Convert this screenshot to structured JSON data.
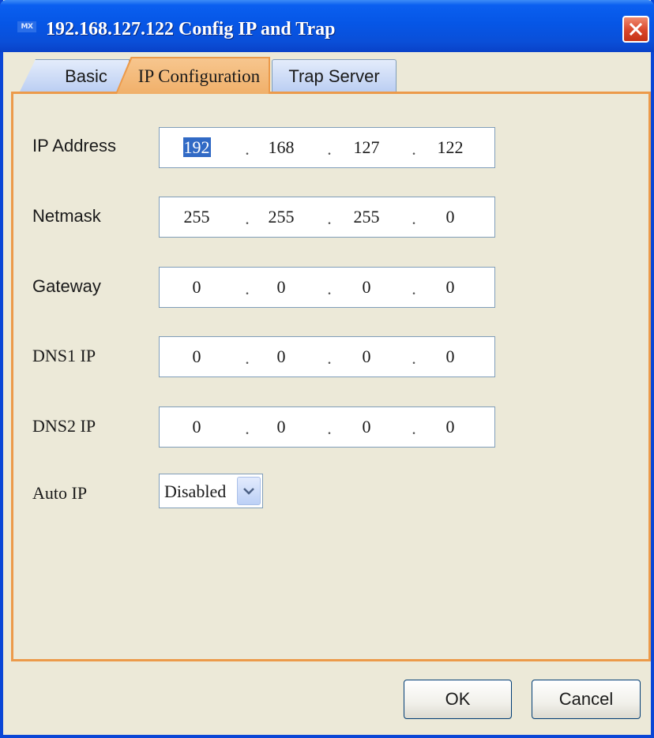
{
  "window": {
    "icon_text": "MX",
    "title": "192.168.127.122 Config IP and Trap"
  },
  "tabs": [
    {
      "label": "Basic",
      "selected": false
    },
    {
      "label": "IP Configuration",
      "selected": true
    },
    {
      "label": "Trap Server",
      "selected": false
    }
  ],
  "form": {
    "ip_address": {
      "label": "IP Address",
      "octets": [
        "192",
        "168",
        "127",
        "122"
      ],
      "separator": "."
    },
    "netmask": {
      "label": "Netmask",
      "octets": [
        "255",
        "255",
        "255",
        "0"
      ],
      "separator": "."
    },
    "gateway": {
      "label": "Gateway",
      "octets": [
        "0",
        "0",
        "0",
        "0"
      ],
      "separator": "."
    },
    "dns1": {
      "label": "DNS1 IP",
      "octets": [
        "0",
        "0",
        "0",
        "0"
      ],
      "separator": "."
    },
    "dns2": {
      "label": "DNS2 IP",
      "octets": [
        "0",
        "0",
        "0",
        "0"
      ],
      "separator": "."
    },
    "auto_ip": {
      "label": "Auto IP",
      "value": "Disabled"
    }
  },
  "buttons": {
    "ok": "OK",
    "cancel": "Cancel"
  },
  "colors": {
    "titlebar": "#0656e6",
    "active_tab": "#f0b06a",
    "panel_border": "#ec9a4a",
    "selection": "#316ac5",
    "close_button": "#d9462a"
  }
}
